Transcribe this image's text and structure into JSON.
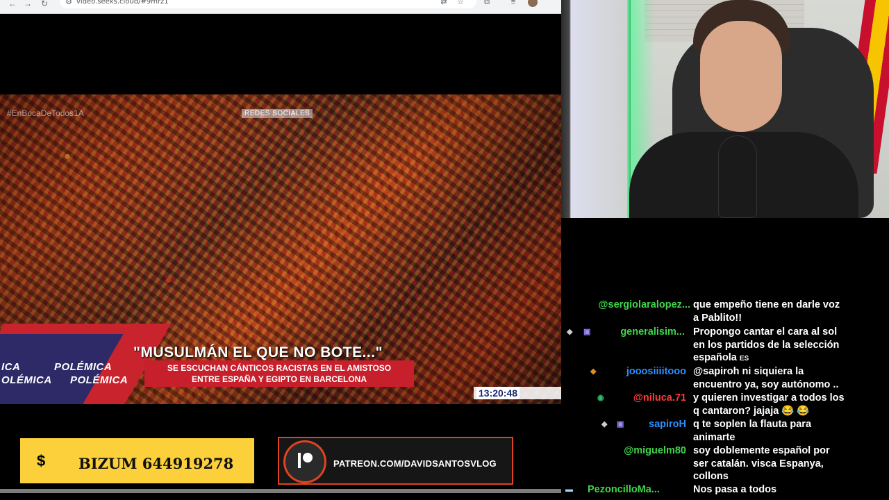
{
  "browser": {
    "url": "video.seeks.cloud/#9mrz1"
  },
  "video": {
    "hashtag": "#EnBocaDeTodos1A",
    "social_tag": "REDES SOCIALES",
    "polemica": [
      "ICA",
      "POLÉMICA",
      "OLÉMICA",
      "POLÉMICA"
    ],
    "headline": "\"MUSULMÁN EL QUE NO BOTE...\"",
    "sub_line1": "SE ESCUCHAN CÁNTICOS RACISTAS EN EL AMISTOSO",
    "sub_line2": "ENTRE ESPAÑA Y EGIPTO EN BARCELONA",
    "clock": "13:20:48"
  },
  "banners": {
    "bizum_symbol": "$",
    "bizum_text": "BIZUM 644919278",
    "patreon_text": "PATREON.COM/DAVIDSANTOSVLOG"
  },
  "chat": {
    "messages": [
      {
        "user": "@sergiolaralopez...",
        "color": "#3fd64a",
        "lines": [
          "que empeño tiene en darle voz",
          "a Pablito!!"
        ]
      },
      {
        "user": "generalisim...",
        "color": "#3fd64a",
        "lines": [
          "Propongo cantar el cara al sol",
          "en los partidos de la selección",
          "española"
        ]
      },
      {
        "user": "jooosiiiitooo",
        "color": "#2e8fff",
        "lines": [
          "@sapiroh ni siquiera la",
          "encuentro ya, soy autónomo .."
        ]
      },
      {
        "user": "@niluca.71",
        "color": "#ff3b3b",
        "lines": [
          "y quieren investigar a todos los",
          "q cantaron? jajaja"
        ]
      },
      {
        "user": "sapiroH",
        "color": "#2e8fff",
        "lines": [
          "q te soplen la flauta para",
          "animarte"
        ]
      },
      {
        "user": "@miguelm80",
        "color": "#3fd64a",
        "lines": [
          "soy doblemente español por",
          "ser catalán. visca Espanya,",
          "collons"
        ]
      },
      {
        "user": "PezoncilloMa...",
        "color": "#3fd64a",
        "lines": [
          "Nos pasa a todos"
        ]
      }
    ],
    "inline_badge": "ES",
    "emoji": "😂",
    "colors": {
      "green": "#3fd64a",
      "blue": "#2e8fff",
      "red": "#ff3b3b"
    }
  }
}
